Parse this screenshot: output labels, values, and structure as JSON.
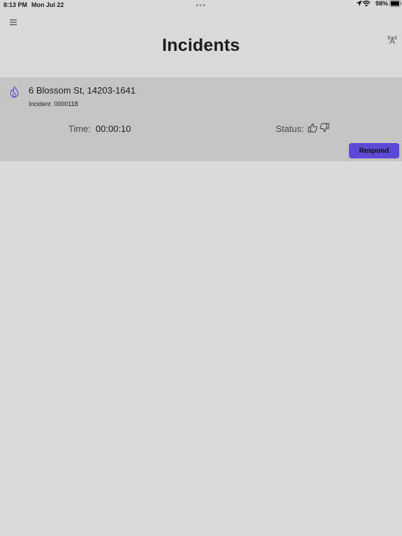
{
  "status_bar": {
    "time": "8:13 PM",
    "date": "Mon Jul 22",
    "battery_percent": "98%",
    "battery_level": 0.98
  },
  "nav": {
    "title": "Incidents",
    "left_icon": "hamburger-menu-icon",
    "right_icon": "antenna-broadcast-icon"
  },
  "incidents": [
    {
      "icon": "fire-icon",
      "address": "6 Blossom St, 14203-1641",
      "incident_label": "Incident  0000118",
      "time_label": "Time:",
      "time_value": "00:00:10",
      "status_label": "Status:",
      "status_icons": [
        "thumbs-up-icon",
        "thumbs-down-icon"
      ],
      "respond_label": "Respond"
    }
  ],
  "colors": {
    "background": "#d9d9d9",
    "card": "#c4c4c4",
    "accent": "#5b4ad6",
    "fire_icon": "#5b4ad6"
  }
}
